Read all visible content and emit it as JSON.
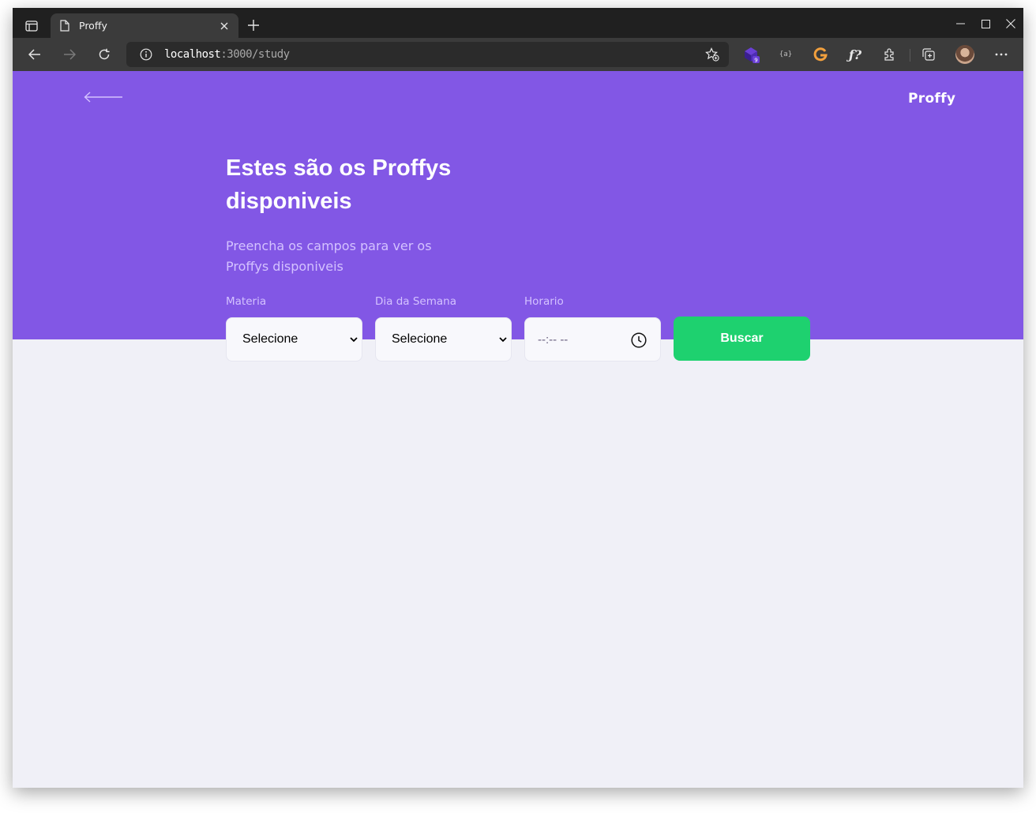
{
  "browser": {
    "tab": {
      "title": "Proffy"
    },
    "address": {
      "host": "localhost",
      "rest": ":3000/study"
    },
    "extension_badge": "9"
  },
  "page": {
    "logo": "Proffy",
    "title": "Estes são os Proffys disponiveis",
    "description": "Preencha os campos para ver os Proffys disponiveis",
    "filters": {
      "subject": {
        "label": "Materia",
        "value": "Selecione"
      },
      "weekday": {
        "label": "Dia da Semana",
        "value": "Selecione"
      },
      "time": {
        "label": "Horario",
        "placeholder": "--:-- --"
      }
    },
    "search_button": "Buscar"
  },
  "colors": {
    "primary": "#8257e5",
    "primary_text_light": "#d4c2ff",
    "background": "#f0f0f7",
    "button_green": "#1ed16f"
  }
}
